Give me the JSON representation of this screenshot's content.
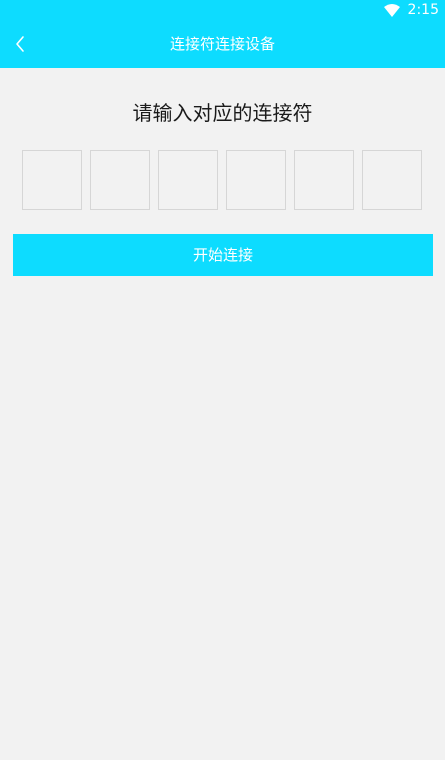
{
  "status_bar": {
    "time": "2:15",
    "wifi_icon": "wifi-icon"
  },
  "app_bar": {
    "title": "连接符连接设备",
    "back_icon": "chevron-left-icon",
    "color": "#0ddcff"
  },
  "prompt": "请输入对应的连接符",
  "code_inputs": {
    "count": 6,
    "values": [
      "",
      "",
      "",
      "",
      "",
      ""
    ]
  },
  "connect_button": {
    "label": "开始连接",
    "color": "#0ddcff"
  },
  "background_color": "#f2f2f2"
}
